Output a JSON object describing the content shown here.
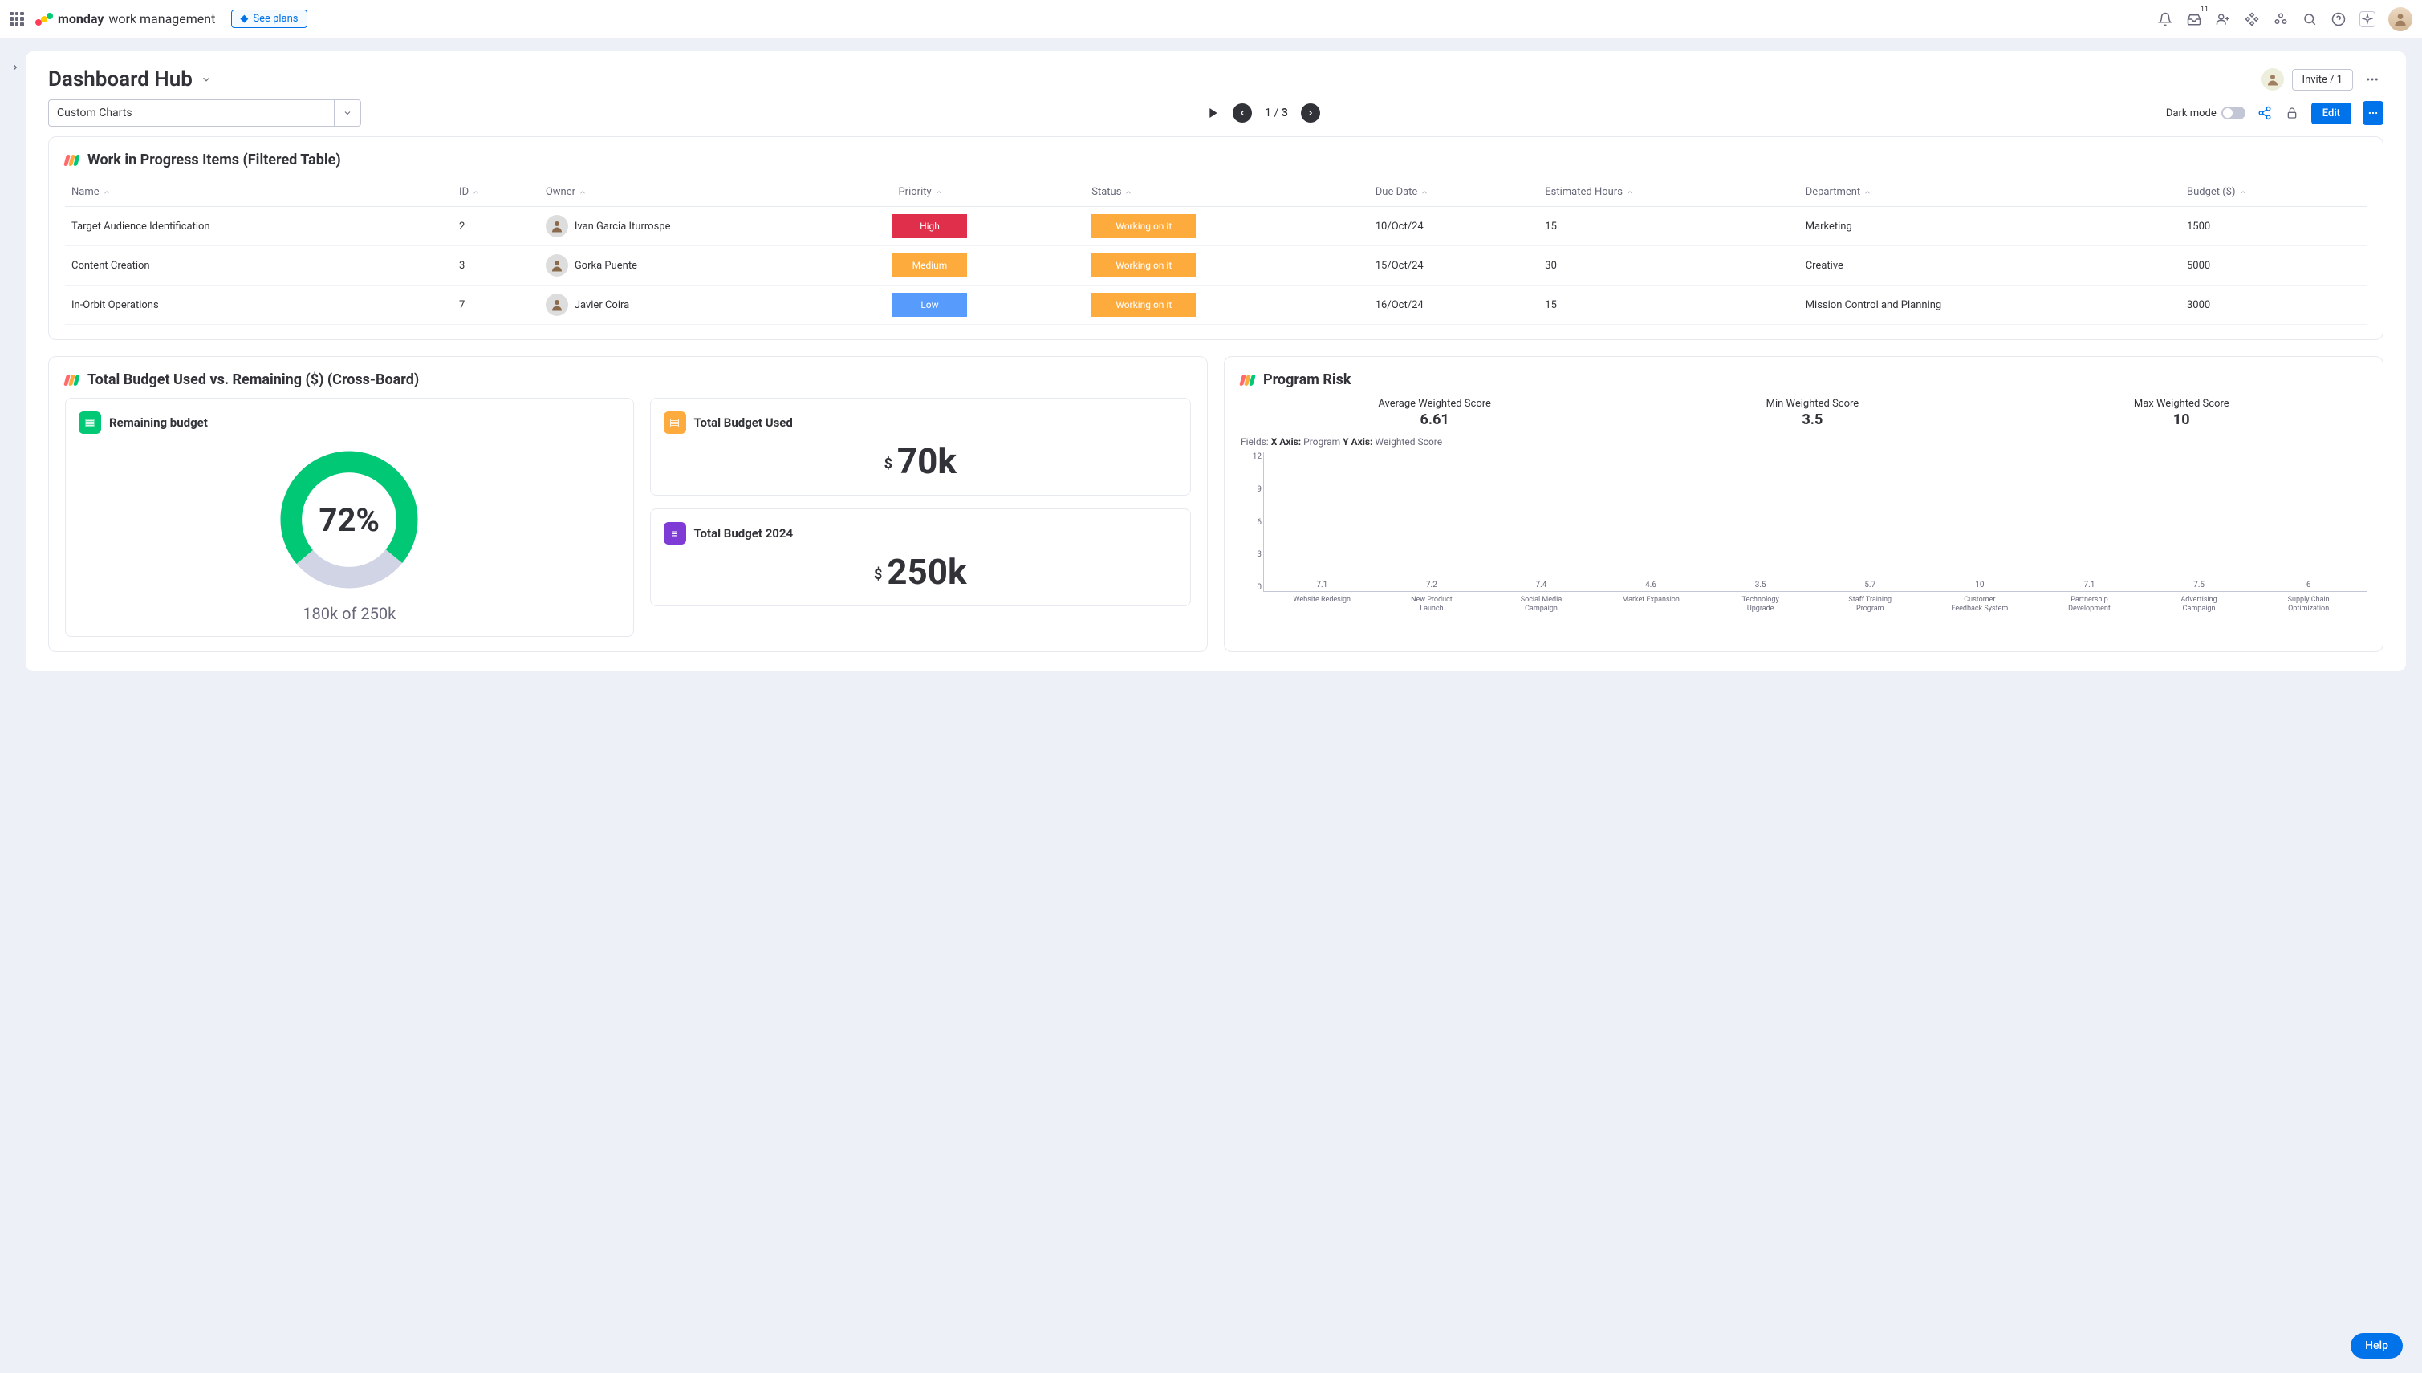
{
  "topbar": {
    "brand_bold": "monday",
    "brand_sub": "work management",
    "see_plans": "See plans",
    "inbox_badge": "11"
  },
  "board": {
    "title": "Dashboard Hub",
    "invite": "Invite / 1",
    "selector": "Custom Charts",
    "page": {
      "current": "1",
      "sep": "/",
      "total": "3"
    },
    "dark_mode": "Dark mode",
    "edit": "Edit"
  },
  "wip": {
    "title": "Work in Progress Items (Filtered Table)",
    "headers": {
      "name": "Name",
      "id": "ID",
      "owner": "Owner",
      "priority": "Priority",
      "status": "Status",
      "due": "Due Date",
      "est": "Estimated Hours",
      "dept": "Department",
      "budget": "Budget ($)"
    },
    "rows": [
      {
        "name": "Target Audience Identification",
        "id": "2",
        "owner": "Ivan Garcia Iturrospe",
        "priority": "High",
        "pcls": "p-high",
        "status": "Working on it",
        "due": "10/Oct/24",
        "est": "15",
        "dept": "Marketing",
        "budget": "1500"
      },
      {
        "name": "Content Creation",
        "id": "3",
        "owner": "Gorka Puente",
        "priority": "Medium",
        "pcls": "p-med",
        "status": "Working on it",
        "due": "15/Oct/24",
        "est": "30",
        "dept": "Creative",
        "budget": "5000"
      },
      {
        "name": "In-Orbit Operations",
        "id": "7",
        "owner": "Javier Coira",
        "priority": "Low",
        "pcls": "p-low",
        "status": "Working on it",
        "due": "16/Oct/24",
        "est": "15",
        "dept": "Mission Control and Planning",
        "budget": "3000"
      }
    ]
  },
  "budget": {
    "title": "Total Budget Used vs. Remaining ($) (Cross-Board)",
    "remaining_label": "Remaining budget",
    "remaining_pct": "72%",
    "remaining_sub": "180k of 250k",
    "used_label": "Total Budget Used",
    "used_val": "70k",
    "total_label": "Total Budget 2024",
    "total_val": "250k",
    "curr": "$"
  },
  "risk": {
    "title": "Program Risk",
    "avg": {
      "label": "Average Weighted Score",
      "value": "6.61"
    },
    "min": {
      "label": "Min Weighted Score",
      "value": "3.5"
    },
    "max": {
      "label": "Max Weighted Score",
      "value": "10"
    },
    "fields_prefix": "Fields: ",
    "x_label": "X Axis:",
    "x_val": " Program ",
    "y_label": "Y Axis:",
    "y_val": " Weighted Score",
    "y_ticks": [
      "12",
      "9",
      "6",
      "3",
      "0"
    ]
  },
  "help": "Help",
  "chart_data": {
    "type": "bar",
    "title": "Program Risk",
    "xlabel": "Program",
    "ylabel": "Weighted Score",
    "ylim": [
      0,
      12
    ],
    "categories": [
      "Website Redesign",
      "New Product Launch",
      "Social Media Campaign",
      "Market Expansion",
      "Technology Upgrade",
      "Staff Training Program",
      "Customer Feedback System",
      "Partnership Development",
      "Advertising Campaign",
      "Supply Chain Optimization"
    ],
    "values": [
      7.1,
      7.2,
      7.4,
      4.6,
      3.5,
      5.7,
      10,
      7.1,
      7.5,
      6
    ],
    "colors": [
      "#fdab3d",
      "#fdab3d",
      "#ff6b6b",
      "#00c875",
      "#00c875",
      "#00c875",
      "#ff6b6b",
      "#fdab3d",
      "#ff6b6b",
      "#00c875"
    ]
  }
}
